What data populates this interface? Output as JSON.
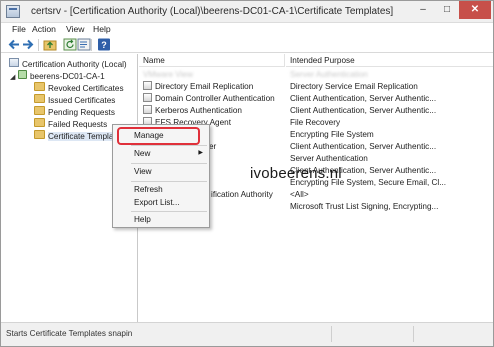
{
  "window": {
    "title": "certsrv - [Certification Authority (Local)\\beerens-DC01-CA-1\\Certificate Templates]",
    "minimize": "–",
    "maximize": "□",
    "close": "✕"
  },
  "menubar": {
    "file": "File",
    "action": "Action",
    "view": "View",
    "help": "Help"
  },
  "toolbar": {
    "icons": [
      "back-arrow-icon",
      "forward-arrow-icon",
      "up-folder-icon",
      "refresh-icon",
      "export-list-icon",
      "help-icon"
    ]
  },
  "tree": {
    "root": "Certification Authority (Local)",
    "ca": "beerens-DC01-CA-1",
    "items": [
      "Revoked Certificates",
      "Issued Certificates",
      "Pending Requests",
      "Failed Requests",
      "Certificate Templates"
    ]
  },
  "detail": {
    "columns": {
      "name": "Name",
      "purpose": "Intended Purpose"
    },
    "rows": [
      {
        "name": "VMware View",
        "purpose": "Server Authentication"
      },
      {
        "name": "Directory Email Replication",
        "purpose": "Directory Service Email Replication"
      },
      {
        "name": "Domain Controller Authentication",
        "purpose": "Client Authentication, Server Authentic..."
      },
      {
        "name": "Kerberos Authentication",
        "purpose": "Client Authentication, Server Authentic..."
      },
      {
        "name": "EFS Recovery Agent",
        "purpose": "File Recovery"
      },
      {
        "name": "",
        "purpose": "Encrypting File System"
      },
      {
        "name": "er",
        "purpose": "Client Authentication, Server Authentic..."
      },
      {
        "name": "",
        "purpose": "Server Authentication"
      },
      {
        "name": "",
        "purpose": "Client Authentication, Server Authentic..."
      },
      {
        "name": "",
        "purpose": "Encrypting File System, Secure Email, Cl..."
      },
      {
        "name": "ification Authority",
        "purpose": "<All>"
      },
      {
        "name": "",
        "purpose": "Microsoft Trust List Signing, Encrypting..."
      }
    ]
  },
  "context_menu": {
    "items": [
      "Manage",
      "New",
      "View",
      "Refresh",
      "Export List...",
      "Help"
    ],
    "submenu_arrow": "▶"
  },
  "watermark": "ivobeerens.nl",
  "status": {
    "text": "Starts Certificate Templates snapin"
  },
  "colors": {
    "highlight_border": "#e0303a",
    "close_button": "#c7504a",
    "selected_item": "#dde7f4"
  }
}
